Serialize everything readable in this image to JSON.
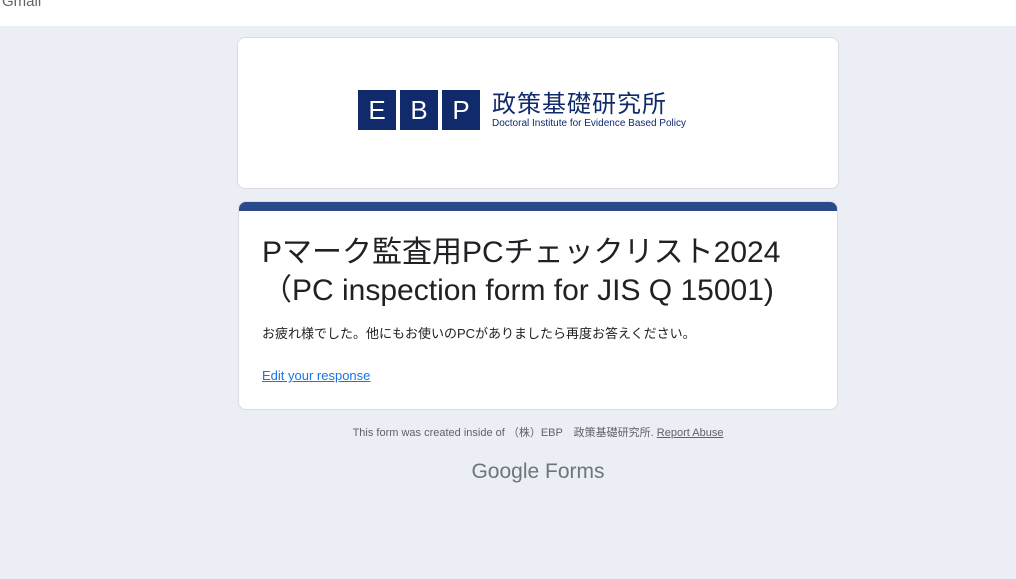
{
  "topbar": {
    "label": "Gmail"
  },
  "header": {
    "logo_letters": [
      "E",
      "B",
      "P"
    ],
    "logo_jp": "政策基礎研究所",
    "logo_en": "Doctoral Institute for  Evidence Based Policy",
    "brand_color": "#102a6b"
  },
  "form": {
    "title": "Pマーク監査用PCチェックリスト2024（PC inspection form for JIS Q 15001)",
    "confirmation_message": "お疲れ様でした。他にもお使いのPCがありましたら再度お答えください。",
    "edit_link": "Edit your response",
    "accent_color": "#2b4a8b"
  },
  "footer": {
    "created_text": "This form was created inside of （株）EBP　政策基礎研究所.",
    "report_link": "Report Abuse",
    "logo_google": "Google",
    "logo_forms": "Forms"
  }
}
